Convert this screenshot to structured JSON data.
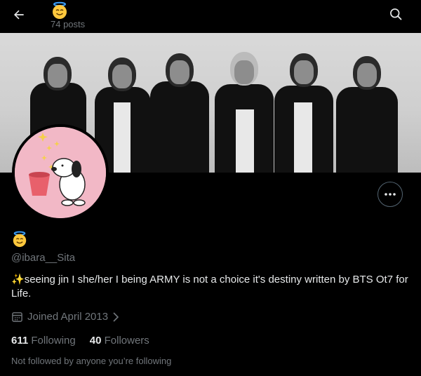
{
  "header": {
    "posts_count": "74 posts",
    "emoji": "smiling-face-with-halo"
  },
  "profile": {
    "handle": "@ibara__Sita",
    "bio_sparkle": "✨",
    "bio": "seeing jin I she/her I being ARMY is not a choice it's destiny written by BTS Ot7 for Life.",
    "joined": "Joined April 2013",
    "following_count": "611",
    "following_label": "Following",
    "followers_count": "40",
    "followers_label": "Followers",
    "mutuals_note": "Not followed by anyone you’re following"
  },
  "colors": {
    "background": "#000000",
    "text": "#e7e9ea",
    "muted": "#71767b",
    "avatar_bg": "#f2b8c6"
  }
}
